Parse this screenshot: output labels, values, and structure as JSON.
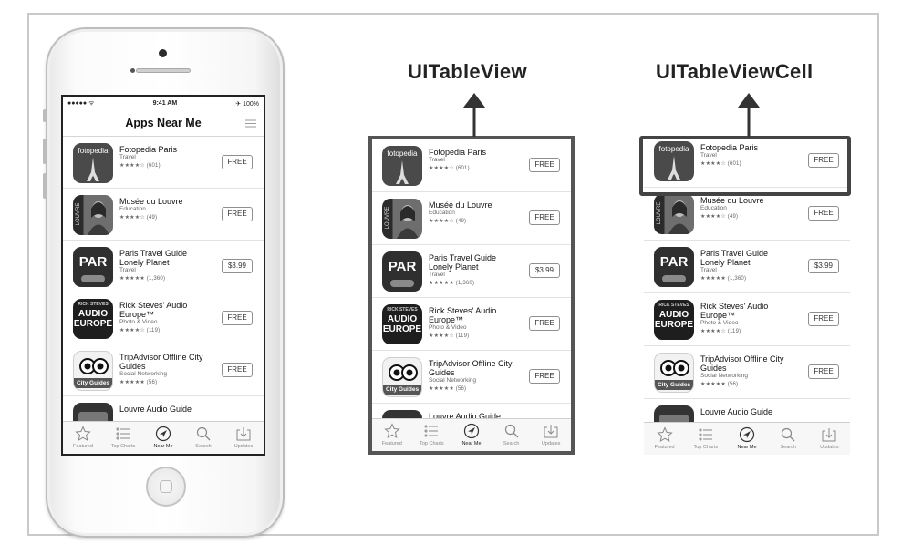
{
  "labels": {
    "table_view": "UITableView",
    "table_view_cell": "UITableViewCell"
  },
  "status_bar": {
    "carrier": "●●●●● ᯤ",
    "time": "9:41 AM",
    "battery": "✈ 100%"
  },
  "nav": {
    "title": "Apps Near Me",
    "list_icon": "list-icon"
  },
  "apps": [
    {
      "name": "Fotopedia Paris",
      "category": "Travel",
      "stars": "★★★★☆ (601)",
      "price": "FREE",
      "icon_text": "fotopedia"
    },
    {
      "name": "Musée du Louvre",
      "category": "Education",
      "stars": "★★★★☆ (49)",
      "price": "FREE",
      "icon_text": "LOUVRE"
    },
    {
      "name": "Paris Travel Guide Lonely Planet",
      "category": "Travel",
      "stars": "★★★★★ (1,360)",
      "price": "$3.99",
      "icon_text": "PAR"
    },
    {
      "name": "Rick Steves' Audio Europe™",
      "category": "Photo & Video",
      "stars": "★★★★☆ (119)",
      "price": "FREE",
      "icon_text": "AUDIO EUROPE"
    },
    {
      "name": "TripAdvisor Offline City Guides",
      "category": "Social Networking",
      "stars": "★★★★★ (56)",
      "price": "FREE",
      "icon_text": "City Guides"
    },
    {
      "name": "Louvre Audio Guide",
      "category": "",
      "stars": "",
      "price": "",
      "icon_text": ""
    }
  ],
  "tabs": [
    {
      "label": "Featured",
      "icon": "star-icon"
    },
    {
      "label": "Top Charts",
      "icon": "list-icon"
    },
    {
      "label": "Near Me",
      "icon": "location-icon"
    },
    {
      "label": "Search",
      "icon": "search-icon"
    },
    {
      "label": "Updates",
      "icon": "download-icon"
    }
  ]
}
